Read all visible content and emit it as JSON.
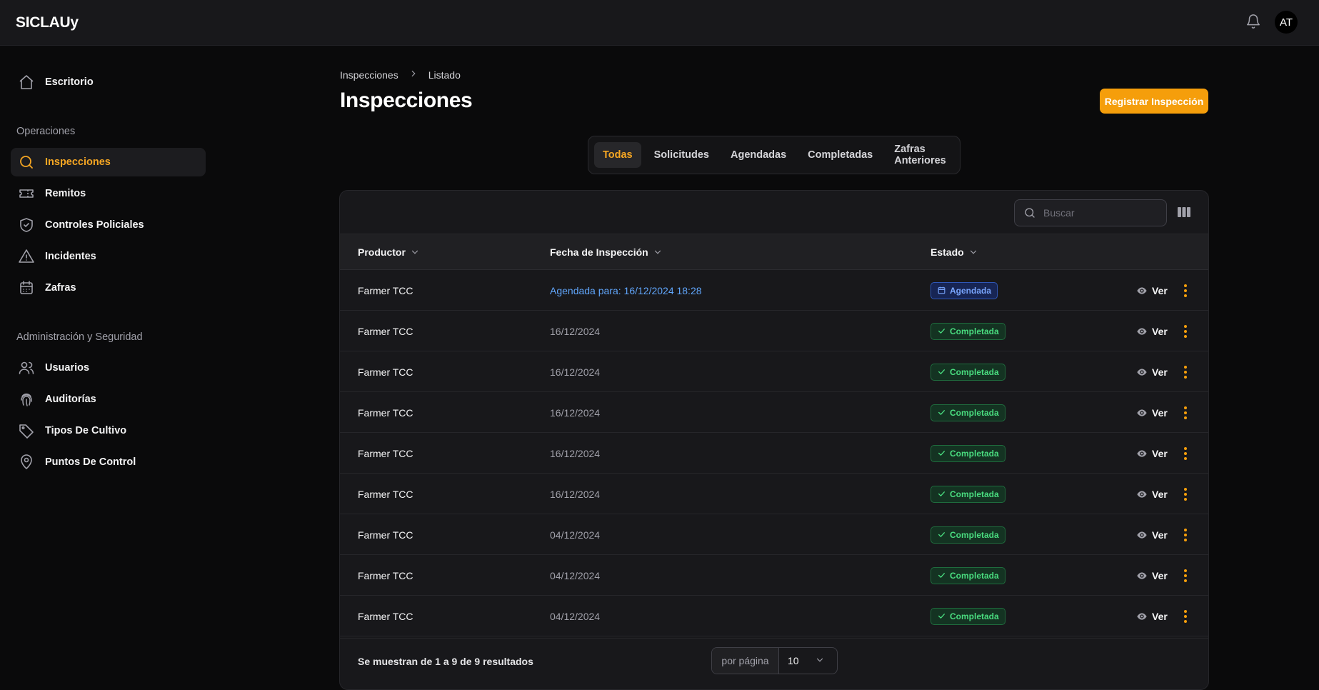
{
  "app": {
    "brand": "SICLAUy",
    "user_initials": "AT"
  },
  "sidebar": {
    "top_item": {
      "label": "Escritorio",
      "icon": "home-icon"
    },
    "groups": [
      {
        "title": "Operaciones",
        "items": [
          {
            "label": "Inspecciones",
            "icon": "search-icon",
            "active": true
          },
          {
            "label": "Remitos",
            "icon": "ticket-icon"
          },
          {
            "label": "Controles Policiales",
            "icon": "shield-check-icon"
          },
          {
            "label": "Incidentes",
            "icon": "warning-icon"
          },
          {
            "label": "Zafras",
            "icon": "calendar-icon"
          }
        ]
      },
      {
        "title": "Administración y Seguridad",
        "items": [
          {
            "label": "Usuarios",
            "icon": "users-icon"
          },
          {
            "label": "Auditorías",
            "icon": "fingerprint-icon"
          },
          {
            "label": "Tipos De Cultivo",
            "icon": "tag-icon"
          },
          {
            "label": "Puntos De Control",
            "icon": "map-pin-icon"
          }
        ]
      }
    ]
  },
  "breadcrumb": [
    "Inspecciones",
    "Listado"
  ],
  "page": {
    "title": "Inspecciones",
    "primary_action": "Registrar Inspección"
  },
  "tabs": [
    {
      "label": "Todas",
      "active": true
    },
    {
      "label": "Solicitudes"
    },
    {
      "label": "Agendadas"
    },
    {
      "label": "Completadas"
    },
    {
      "label": "Zafras Anteriores"
    }
  ],
  "table": {
    "search_placeholder": "Buscar",
    "columns": [
      "Productor",
      "Fecha de Inspección",
      "Estado"
    ],
    "view_label": "Ver",
    "rows": [
      {
        "producer": "Farmer TCC",
        "date": "Agendada para: 16/12/2024 18:28",
        "status": "Agendada",
        "status_type": "scheduled"
      },
      {
        "producer": "Farmer TCC",
        "date": "16/12/2024",
        "status": "Completada",
        "status_type": "done"
      },
      {
        "producer": "Farmer TCC",
        "date": "16/12/2024",
        "status": "Completada",
        "status_type": "done"
      },
      {
        "producer": "Farmer TCC",
        "date": "16/12/2024",
        "status": "Completada",
        "status_type": "done"
      },
      {
        "producer": "Farmer TCC",
        "date": "16/12/2024",
        "status": "Completada",
        "status_type": "done"
      },
      {
        "producer": "Farmer TCC",
        "date": "16/12/2024",
        "status": "Completada",
        "status_type": "done"
      },
      {
        "producer": "Farmer TCC",
        "date": "04/12/2024",
        "status": "Completada",
        "status_type": "done"
      },
      {
        "producer": "Farmer TCC",
        "date": "04/12/2024",
        "status": "Completada",
        "status_type": "done"
      },
      {
        "producer": "Farmer TCC",
        "date": "04/12/2024",
        "status": "Completada",
        "status_type": "done"
      }
    ],
    "footer_text": "Se muestran de 1 a 9 de 9 resultados",
    "per_page_label": "por página",
    "per_page_value": "10"
  },
  "colors": {
    "accent": "#f59e0b",
    "completed": "#4ade80",
    "scheduled": "#60a5fa"
  }
}
